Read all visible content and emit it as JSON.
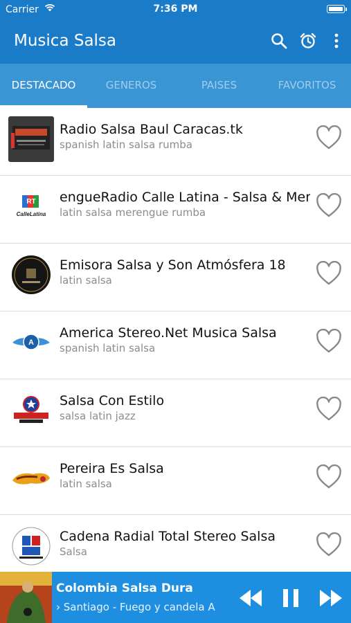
{
  "status_bar": {
    "carrier": "Carrier",
    "time": "7:36 PM"
  },
  "app_bar": {
    "title": "Musica Salsa",
    "icons": [
      "search-icon",
      "alarm-clock-icon",
      "more-vertical-icon"
    ]
  },
  "tabs": [
    {
      "label": "DESTACADO",
      "active": true
    },
    {
      "label": "GENEROS",
      "active": false
    },
    {
      "label": "PAISES",
      "active": false
    },
    {
      "label": "FAVORITOS",
      "active": false
    }
  ],
  "stations": [
    {
      "name": "Radio Salsa Baul Caracas.tk",
      "tags": "spanish latin salsa rumba"
    },
    {
      "name": "engueRadio Calle Latina - Salsa & Mere",
      "tags": "latin salsa merengue rumba"
    },
    {
      "name": "Emisora Salsa y Son Atmósfera 18",
      "tags": "latin salsa"
    },
    {
      "name": "America Stereo.Net Musica Salsa",
      "tags": "spanish latin salsa"
    },
    {
      "name": "Salsa Con Estilo",
      "tags": "salsa latin jazz"
    },
    {
      "name": "Pereira Es Salsa",
      "tags": "latin salsa"
    },
    {
      "name": "Cadena Radial Total Stereo Salsa",
      "tags": "Salsa"
    }
  ],
  "player": {
    "station": "Colombia Salsa Dura",
    "track": "Santiago - Fuego y candela   A",
    "controls": [
      "rewind-icon",
      "pause-icon",
      "fast-forward-icon"
    ]
  },
  "colors": {
    "primary": "#1a7bc9",
    "tab_bar": "#3a95d5",
    "player": "#1e8fe0",
    "heart": "#888888"
  }
}
